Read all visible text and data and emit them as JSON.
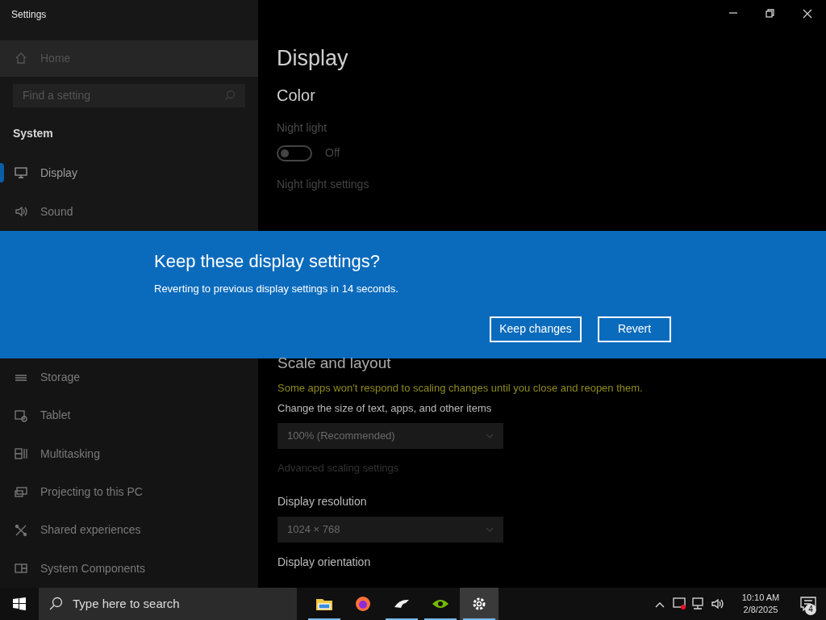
{
  "window": {
    "title": "Settings"
  },
  "sidebar": {
    "home": "Home",
    "search_placeholder": "Find a setting",
    "section": "System",
    "items": [
      {
        "kind": "display",
        "label": "Display",
        "selected": true
      },
      {
        "kind": "sound",
        "label": "Sound",
        "selected": false
      }
    ],
    "items_below": [
      {
        "kind": "storage",
        "label": "Storage",
        "selected": false
      },
      {
        "kind": "tablet",
        "label": "Tablet",
        "selected": false
      },
      {
        "kind": "multitasking",
        "label": "Multitasking",
        "selected": false
      },
      {
        "kind": "projecting",
        "label": "Projecting to this PC",
        "selected": false
      },
      {
        "kind": "shared",
        "label": "Shared experiences",
        "selected": false
      },
      {
        "kind": "components",
        "label": "System Components",
        "selected": false
      }
    ]
  },
  "content": {
    "title": "Display",
    "color_heading": "Color",
    "night_light": {
      "label": "Night light",
      "on": false,
      "state_text": "Off"
    },
    "night_light_link": "Night light settings",
    "scale_heading": "Scale and layout",
    "warning": "Some apps won't respond to scaling changes until you close and reopen them.",
    "size_label": "Change the size of text, apps, and other items",
    "size_value": "100% (Recommended)",
    "advanced_link": "Advanced scaling settings",
    "resolution_label": "Display resolution",
    "resolution_value": "1024 × 768",
    "orientation_label": "Display orientation"
  },
  "dialog": {
    "title": "Keep these display settings?",
    "message": "Reverting to previous display settings in 14 seconds.",
    "buttons": [
      "Keep changes",
      "Revert"
    ]
  },
  "taskbar": {
    "search_placeholder": "Type here to search",
    "apps": [
      {
        "kind": "folder",
        "running": true,
        "selected": false
      },
      {
        "kind": "browser",
        "running": false,
        "selected": false
      },
      {
        "kind": "bird",
        "running": true,
        "selected": false
      },
      {
        "kind": "eye",
        "running": true,
        "selected": false
      },
      {
        "kind": "gear",
        "running": true,
        "selected": true
      }
    ],
    "time": "10:10 AM",
    "date": "2/8/2025",
    "notifications": "4"
  }
}
